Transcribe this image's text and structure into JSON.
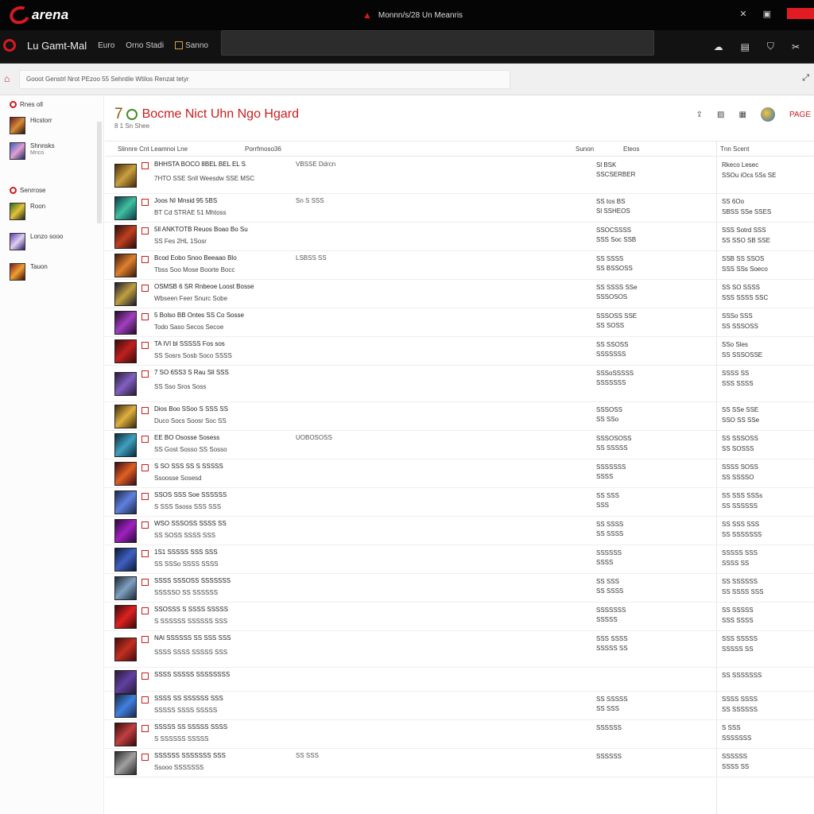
{
  "app": {
    "name": "arena",
    "window_title": "Monnn/s/28 Un Meanris"
  },
  "colors": {
    "accent": "#d71920",
    "topbar": "#050505",
    "navbar": "#121212"
  },
  "nav": {
    "brand": "Lu Gamt-Mal",
    "tabs": [
      "Euro",
      "Orno Stadi",
      "Sanno"
    ],
    "right_icons": [
      "cloud-icon",
      "list-icon",
      "shield-icon",
      "tools-icon"
    ]
  },
  "address": {
    "text": "Gooot Genstrl Nrot PEzoo 55 Sehntile Wtilos Renzat tetyr",
    "right_icon": "expand-icon"
  },
  "sidebar": {
    "head1": "Rnes oll",
    "items1": [
      {
        "title": "Hicstorr",
        "sub": ""
      },
      {
        "title": "Shnnsks",
        "sub": "Mnco"
      }
    ],
    "head2": "Senrrose",
    "items2": [
      {
        "title": "Roon",
        "sub": ""
      },
      {
        "title": "Lonzo sooo",
        "sub": ""
      },
      {
        "title": "Tauon",
        "sub": ""
      }
    ]
  },
  "main": {
    "page_num": "7",
    "title": "Bocme Nict Uhn Ngo Hgard",
    "subtitle": "8 1 Sn Shee",
    "tools": [
      "upload-icon",
      "image-icon",
      "grid-icon",
      "globe-icon"
    ],
    "tool_label": "PAGE",
    "columns": {
      "c1": "Slinnre Cnt Leamnoi Lne",
      "c2": "Porrfmoso36",
      "c3": "Sunon",
      "c4": "Eteos",
      "c5": "Tnn Scent"
    },
    "rows": [
      {
        "l1": "BHHSTA BOCO 8BEL BEL EL S",
        "l2": "7HTO SSE Snll Weesdw SSE MSC",
        "mid": "VBSSE Ddrcn",
        "c1a": "Sl BSK",
        "c1b": "SSCSERBER",
        "c2a": "Rkeco Lesec",
        "c2b": "SSOu iOcs 5Ss SE"
      },
      {
        "l1": "Joos NI Mnsid 95 5BS",
        "l2": "BT Cd STRAE 51 Mhtoss",
        "mid": "Sn S SSS",
        "c1a": "SS tos BS",
        "c1b": "Sl SSHEOS",
        "c2a": "SS 6Oo",
        "c2b": "SBSS SSe SSES"
      },
      {
        "l1": "5ll ANKTOTB Reuos Boao Bo Su",
        "l2": "SS Fes 2HL 1Sosr",
        "mid": "",
        "c1a": "SSOCSSSS",
        "c1b": "SSS Soc SSB",
        "c2a": "SSS Sotrd SSS",
        "c2b": "SS SSO SB SSE"
      },
      {
        "l1": "Bcod Eobo Snoo Beeaao Blo",
        "l2": "Tbss Soo Mose Boorte Bocc",
        "mid": "LSBSS SS",
        "c1a": "SS SSSS",
        "c1b": "SS BSSOSS",
        "c2a": "SSB SS SSOS",
        "c2b": "SSS SSs Soeco"
      },
      {
        "l1": "OSMSB 6 SR Rnbeoe Loost Bosse",
        "l2": "Wbseen Feer Snurc Sobe",
        "mid": "",
        "c1a": "SS SSSS SSe",
        "c1b": "SSSOSOS",
        "c2a": "SS SO SSSS",
        "c2b": "SSS SSSS SSC"
      },
      {
        "l1": "5 Bolso BB Ontes SS Co Sosse",
        "l2": "Todo Saso Secos Secoe",
        "mid": "",
        "c1a": "SSSOSS SSE",
        "c1b": "SS SOSS",
        "c2a": "SSSo SSS",
        "c2b": "SS SSSOSS"
      },
      {
        "l1": "TA IVI bl SSSSS Fos sos",
        "l2": "SS Sosrs Sosb Soco SSSS",
        "mid": "",
        "c1a": "SS SSOSS",
        "c1b": "SSSSSSS",
        "c2a": "SSo Sles",
        "c2b": "SS SSSOSSE"
      },
      {
        "l1": "7 SO 6SS3 S Rau Sll SSS",
        "l2": "SS Sso Sros Soss",
        "mid": "",
        "c1a": "SSSoSSSSS",
        "c1b": "SSSSSSS",
        "c2a": "SSSS SS",
        "c2b": "SSS SSSS"
      },
      {
        "l1": "Dios Boo SSoo S SSS SS",
        "l2": "Duco Socs Soosr Soc SS",
        "mid": "",
        "c1a": "SSSOSS",
        "c1b": "SS SSo",
        "c2a": "SS SSe SSE",
        "c2b": "SSO SS SSe"
      },
      {
        "l1": "EE BO Ososse Sosess",
        "l2": "SS Gost Sosso SS Sosso",
        "mid": "UOBOSOSS",
        "c1a": "SSSOSOSS",
        "c1b": "SS SSSSS",
        "c2a": "SS SSSOSS",
        "c2b": "SS SOSSS"
      },
      {
        "l1": "S SO SSS SS S SSSSS",
        "l2": "Ssoosse Sosesd",
        "mid": "",
        "c1a": "SSSSSSS",
        "c1b": "SSSS",
        "c2a": "SSSS SOSS",
        "c2b": "SS SSSSO"
      },
      {
        "l1": "SSOS SSS Soe SSSSSS",
        "l2": "S SSS Ssoss SSS SSS",
        "mid": "",
        "c1a": "SS SSS",
        "c1b": "SSS",
        "c2a": "SS SSS SSSs",
        "c2b": "SS SSSSSS"
      },
      {
        "l1": "WSO SSSOSS SSSS SS",
        "l2": "SS SOSS SSSS SSS",
        "mid": "",
        "c1a": "SS SSSS",
        "c1b": "SS SSSS",
        "c2a": "SS SSS SSS",
        "c2b": "SS SSSSSSS"
      },
      {
        "l1": "1S1 SSSSS SSS SSS",
        "l2": "SS SSSo SSSS SSSS",
        "mid": "",
        "c1a": "SSSSSS",
        "c1b": "SSSS",
        "c2a": "SSSSS SSS",
        "c2b": "SSSS SS"
      },
      {
        "l1": "SSSS SSSOSS SSSSSSS",
        "l2": "SSSSSO SS SSSSSS",
        "mid": "",
        "c1a": "SS SSS",
        "c1b": "SS SSSS",
        "c2a": "SS SSSSSS",
        "c2b": "SS SSSS SSS"
      },
      {
        "l1": "SSOSSS S SSSS SSSSS",
        "l2": "S SSSSSS SSSSSS SSS",
        "mid": "",
        "c1a": "SSSSSSS",
        "c1b": "SSSSS",
        "c2a": "SS SSSSS",
        "c2b": "SSS SSSS"
      },
      {
        "l1": "NAl SSSSSS SS SSS SSS",
        "l2": "SSSS SSSS SSSSS SSS",
        "mid": "",
        "c1a": "SSS SSSS",
        "c1b": "SSSSS SS",
        "c2a": "SSS SSSSS",
        "c2b": "SSSSS SS"
      },
      {
        "l1": "SSSS SSSSS SSSSSSSS",
        "l2": "",
        "mid": "",
        "c1a": "",
        "c1b": "",
        "c2a": "SS SSSSSSS",
        "c2b": ""
      },
      {
        "l1": "SSSS SS SSSSSS SSS",
        "l2": "SSSSS SSSS SSSSS",
        "mid": "",
        "c1a": "SS SSSSS",
        "c1b": "SS SSS",
        "c2a": "SSSS SSSS",
        "c2b": "SS SSSSSS"
      },
      {
        "l1": "SSSSS SS SSSSS SSSS",
        "l2": "S SSSSSS SSSSS",
        "mid": "",
        "c1a": "SSSSSS",
        "c1b": "",
        "c2a": "S SSS",
        "c2b": "SSSSSSS"
      },
      {
        "l1": "SSSSSS SSSSSSS SSS",
        "l2": "Ssooo SSSSSSS",
        "mid": "SS SSS",
        "c1a": "SSSSSS",
        "c1b": "",
        "c2a": "SSSSSS",
        "c2b": "SSSS SS"
      }
    ]
  }
}
